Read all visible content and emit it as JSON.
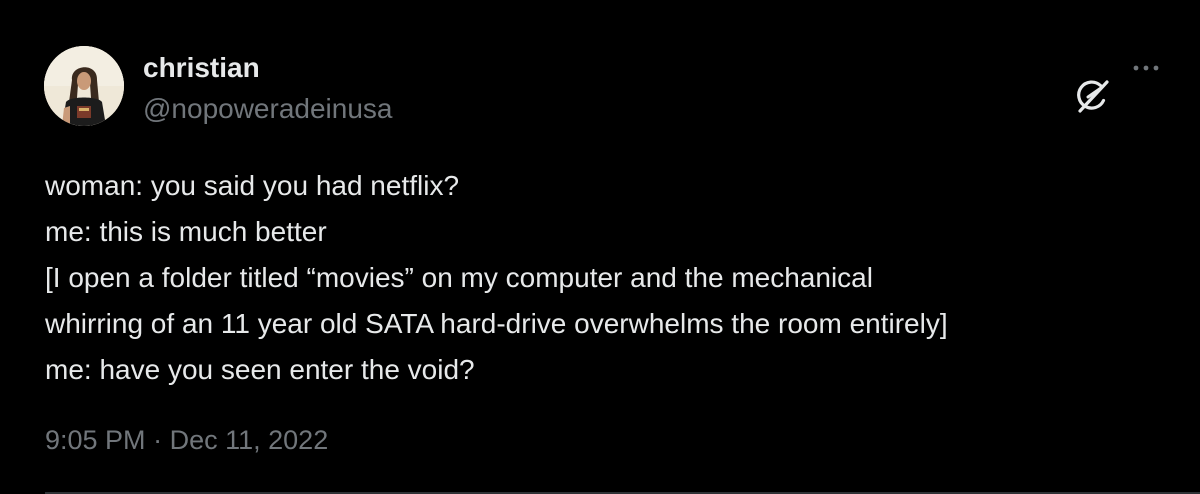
{
  "author": {
    "display_name": "christian",
    "handle": "@nopoweradeinusa",
    "avatar": "profile-photo"
  },
  "icons": {
    "grok": "grok-icon",
    "more": "more-options-icon"
  },
  "tweet": {
    "lines": [
      "woman: you said you had netflix?",
      "me: this is much better",
      "[I open a folder titled “movies” on my computer and the mechanical",
      "whirring of an 11 year old SATA hard-drive overwhelms the room entirely]",
      "me: have you seen enter the void?"
    ]
  },
  "meta": {
    "time": "9:05 PM",
    "separator": "·",
    "date": "Dec 11, 2022"
  },
  "colors": {
    "background": "#000000",
    "text_primary": "#e7e9ea",
    "text_secondary": "#71767b",
    "divider": "#2f3336"
  }
}
